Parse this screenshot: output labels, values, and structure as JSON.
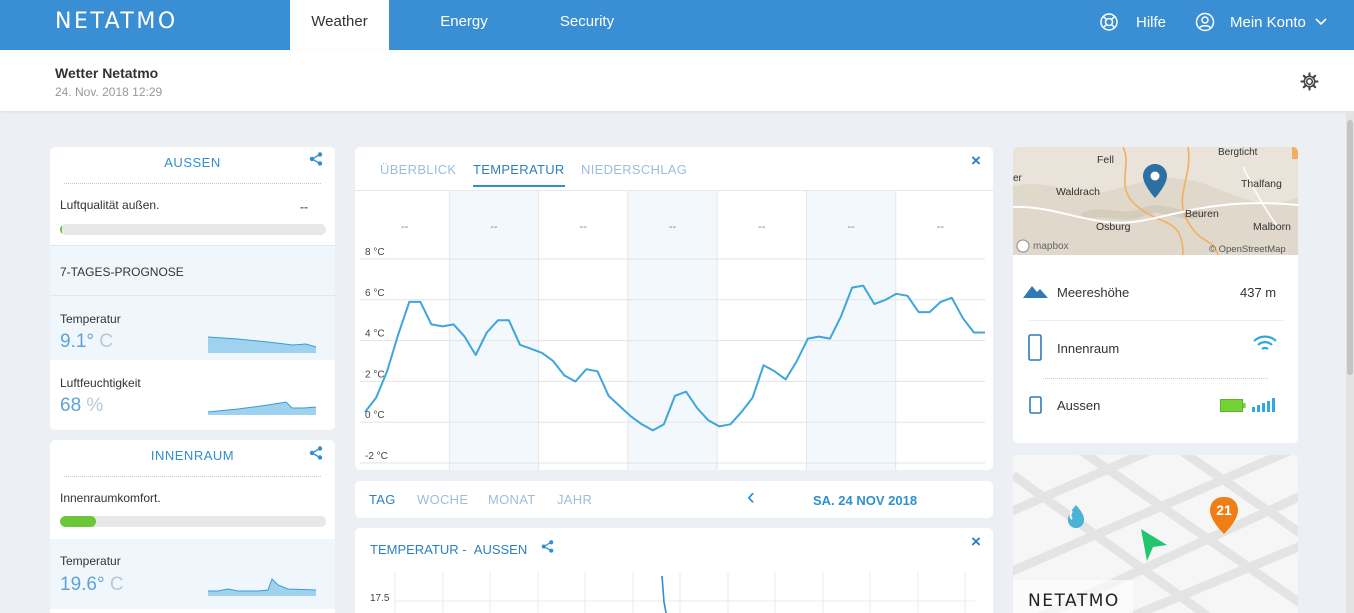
{
  "nav": {
    "logo": "NETATMO",
    "tabs": [
      "Weather",
      "Energy",
      "Security"
    ],
    "help": "Hilfe",
    "account": "Mein Konto"
  },
  "station": {
    "title": "Wetter Netatmo",
    "date": "24. Nov. 2018 12:29"
  },
  "outdoor": {
    "title": "AUSSEN",
    "air_quality_label": "Luftqualität außen.",
    "air_quality_value": "--",
    "forecast_label": "7-TAGES-PROGNOSE",
    "temp_label": "Temperatur",
    "temp_value": "9.1°",
    "temp_unit": "C",
    "hum_label": "Luftfeuchtigkeit",
    "hum_value": "68",
    "hum_unit": "%"
  },
  "indoor": {
    "title": "INNENRAUM",
    "comfort_label": "Innenraumkomfort.",
    "comfort_level": 0.14,
    "temp_label": "Temperatur",
    "temp_value": "19.6°",
    "temp_unit": "C"
  },
  "chart": {
    "tabs": [
      "ÜBERBLICK",
      "TEMPERATUR",
      "NIEDERSCHLAG"
    ],
    "close": "×",
    "day_values": [
      "--",
      "--",
      "--",
      "--",
      "--",
      "--",
      "--"
    ],
    "periods": [
      "TAG",
      "WOCHE",
      "MONAT",
      "JAHR"
    ],
    "date": "SA. 24 NOV 2018",
    "prev": "‹"
  },
  "chart_data": {
    "type": "line",
    "ylim": [
      -2,
      8
    ],
    "yticks": [
      "8 °C",
      "6 °C",
      "4 °C",
      "2 °C",
      "0 °C",
      "-2 °C"
    ],
    "grid": true,
    "series": [
      {
        "values": [
          0.3,
          1.0,
          2.3,
          4.1,
          5.7,
          5.7,
          4.6,
          4.5,
          4.6,
          4.0,
          3.1,
          4.2,
          4.8,
          4.8,
          3.6,
          3.4,
          3.2,
          2.8,
          2.1,
          1.8,
          2.4,
          2.3,
          1.1,
          0.6,
          0.1,
          -0.3,
          -0.6,
          -0.3,
          1.1,
          1.3,
          0.5,
          -0.1,
          -0.4,
          -0.3,
          0.3,
          1.0,
          2.6,
          2.3,
          1.9,
          2.8,
          3.9,
          4.0,
          3.9,
          5.0,
          6.4,
          6.5,
          5.6,
          5.8,
          6.1,
          6.0,
          5.2,
          5.2,
          5.7,
          5.9,
          4.9,
          4.2,
          4.2
        ]
      }
    ]
  },
  "bottom_chart": {
    "title": "TEMPERATUR -",
    "sub": "AUSSEN",
    "close": "×",
    "tick": "17.5"
  },
  "map": {
    "places": [
      "Bergticht",
      "Fell",
      "Waldrach",
      "Thalfang",
      "Beuren",
      "Osburg",
      "Malborn"
    ],
    "attribution": "© OpenStreetMap",
    "mapbox": "mapbox"
  },
  "info": {
    "altitude_label": "Meereshöhe",
    "altitude_value": "437 m",
    "indoor_label": "Innenraum",
    "outdoor_label": "Aussen"
  },
  "promo": {
    "logo": "NETATMO",
    "badge": "21"
  }
}
